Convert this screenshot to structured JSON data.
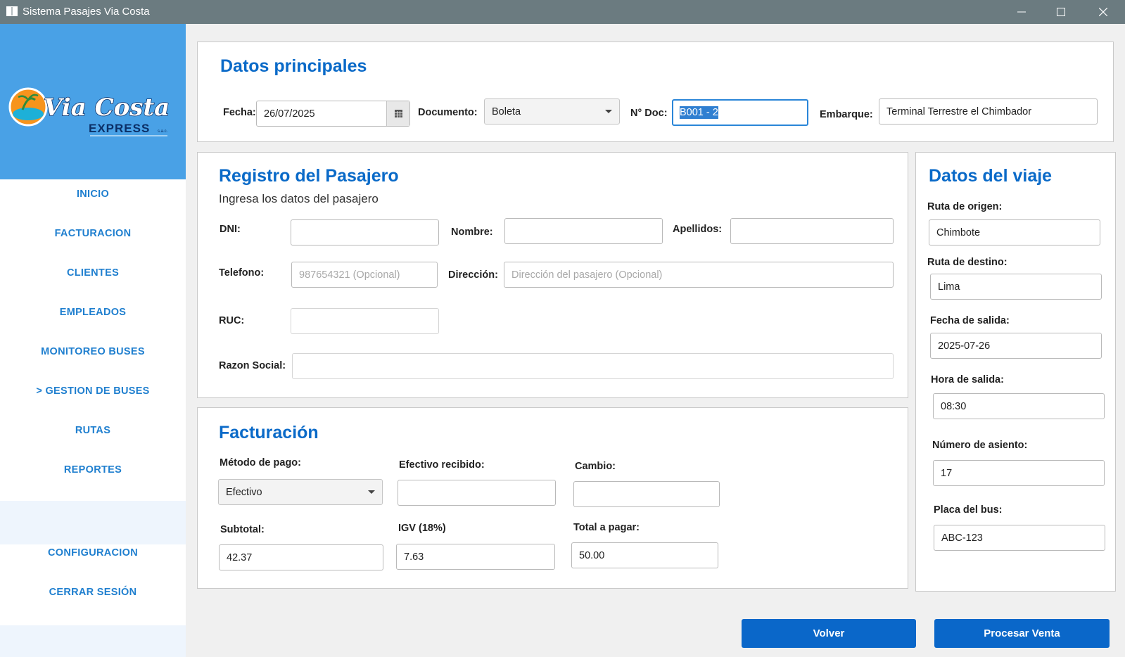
{
  "window": {
    "title": "Sistema Pasajes Via Costa"
  },
  "logo": {
    "brand": "Via Costa",
    "sub": "EXPRESS",
    "suffix": "s.a.c."
  },
  "nav": {
    "inicio": "INICIO",
    "facturacion": "FACTURACION",
    "clientes": "CLIENTES",
    "empleados": "EMPLEADOS",
    "monitoreo": "MONITOREO BUSES",
    "gestion": "> GESTION DE BUSES",
    "rutas": "RUTAS",
    "reportes": "REPORTES",
    "configuracion": "CONFIGURACION",
    "cerrar": "CERRAR SESIÓN"
  },
  "principal": {
    "title": "Datos principales",
    "fecha_label": "Fecha:",
    "fecha_value": "26/07/2025",
    "documento_label": "Documento:",
    "documento_value": "Boleta",
    "ndoc_label": "N° Doc:",
    "ndoc_value": "B001 - 2",
    "embarque_label": "Embarque:",
    "embarque_value": "Terminal Terrestre el Chimbador"
  },
  "pasajero": {
    "title": "Registro del Pasajero",
    "subtitle": "Ingresa los datos del pasajero",
    "dni_label": "DNI:",
    "nombre_label": "Nombre:",
    "apellidos_label": "Apellidos:",
    "telefono_label": "Telefono:",
    "telefono_placeholder": "987654321 (Opcional)",
    "direccion_label": "Dirección:",
    "direccion_placeholder": "Dirección del pasajero (Opcional)",
    "ruc_label": "RUC:",
    "razon_label": "Razon Social:"
  },
  "facturacion": {
    "title": "Facturación",
    "metodo_label": "Método de pago:",
    "metodo_value": "Efectivo",
    "efectivo_label": "Efectivo recibido:",
    "cambio_label": "Cambio:",
    "subtotal_label": "Subtotal:",
    "subtotal_value": "42.37",
    "igv_label": "IGV (18%)",
    "igv_value": "7.63",
    "total_label": "Total a pagar:",
    "total_value": "50.00"
  },
  "viaje": {
    "title": "Datos del viaje",
    "origen_label": "Ruta de origen:",
    "origen_value": "Chimbote",
    "destino_label": "Ruta de destino:",
    "destino_value": "Lima",
    "fecha_label": "Fecha de salida:",
    "fecha_value": "2025-07-26",
    "hora_label": "Hora de salida:",
    "hora_value": "08:30",
    "asiento_label": "Número de asiento:",
    "asiento_value": "17",
    "placa_label": "Placa del bus:",
    "placa_value": "ABC-123"
  },
  "actions": {
    "volver": "Volver",
    "procesar": "Procesar Venta"
  },
  "colors": {
    "accent": "#0a67c9",
    "heading": "#0a6ac8",
    "logo_bg": "#49a1e6",
    "nav": "#1f7fcf",
    "titlebar": "#6b7b80"
  },
  "icons": {
    "calendar": "calendar-icon",
    "dropdown": "chevron-down-icon"
  }
}
